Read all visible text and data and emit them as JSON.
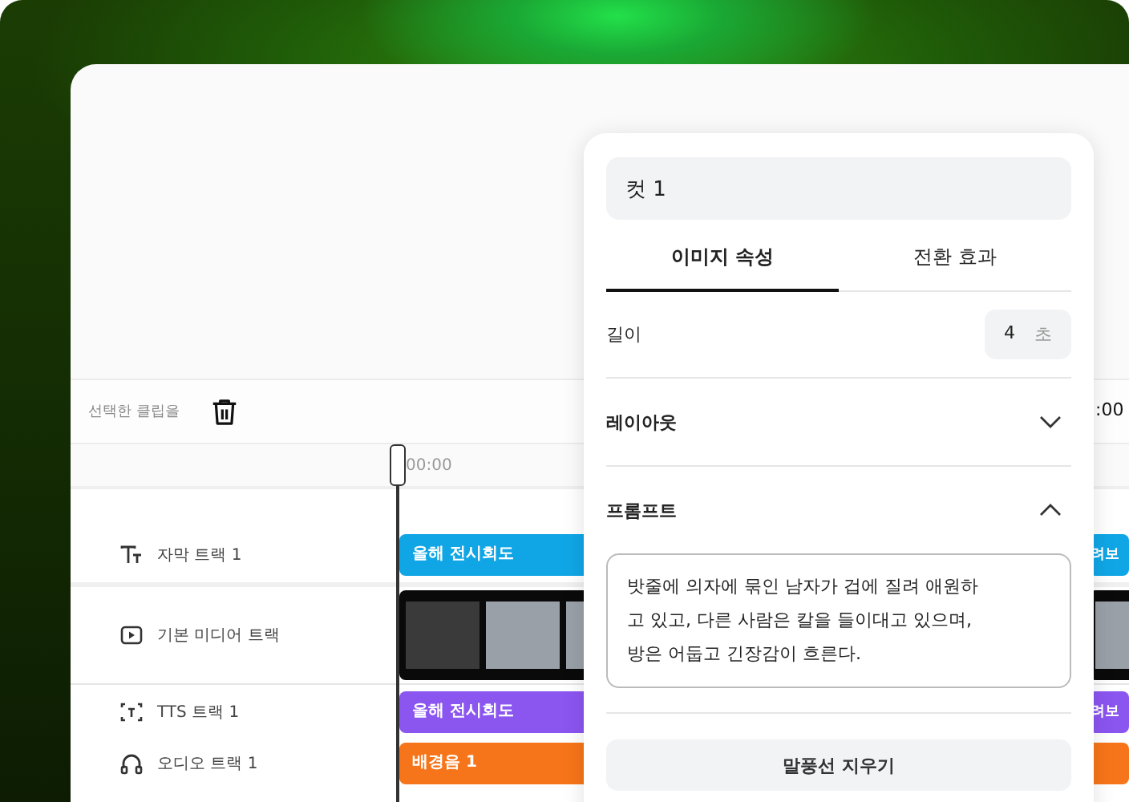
{
  "toolbar": {
    "selection_label": "선택한 클립을"
  },
  "ruler": {
    "start_time": "00:00",
    "end_time": ":00"
  },
  "tracks": [
    {
      "kind": "subtitle",
      "name": "자막 트랙 1",
      "clips": [
        "올해 전시회도",
        "려보"
      ]
    },
    {
      "kind": "media",
      "name": "기본 미디어 트랙"
    },
    {
      "kind": "tts",
      "name": "TTS 트랙 1",
      "clips": [
        "올해 전시회도",
        "려보"
      ]
    },
    {
      "kind": "audio",
      "name": "오디오 트랙 1",
      "clips": [
        "배경음 1"
      ]
    }
  ],
  "panel": {
    "name_value": "컷 1",
    "tabs": [
      {
        "label": "이미지 속성",
        "selected": true
      },
      {
        "label": "전환 효과",
        "selected": false
      }
    ],
    "duration": {
      "label": "길이",
      "value": "4",
      "unit": "초"
    },
    "sections": [
      {
        "title": "레이아웃",
        "expanded": false
      },
      {
        "title": "프롬프트",
        "expanded": true,
        "text": "밧줄에 의자에 묶인 남자가 겁에 질려 애원하고 있고, 다른 사람은 칼을 들이대고 있으며, 방은 어둡고 긴장감이 흐른다."
      }
    ],
    "button": "말풍선 지우기"
  }
}
